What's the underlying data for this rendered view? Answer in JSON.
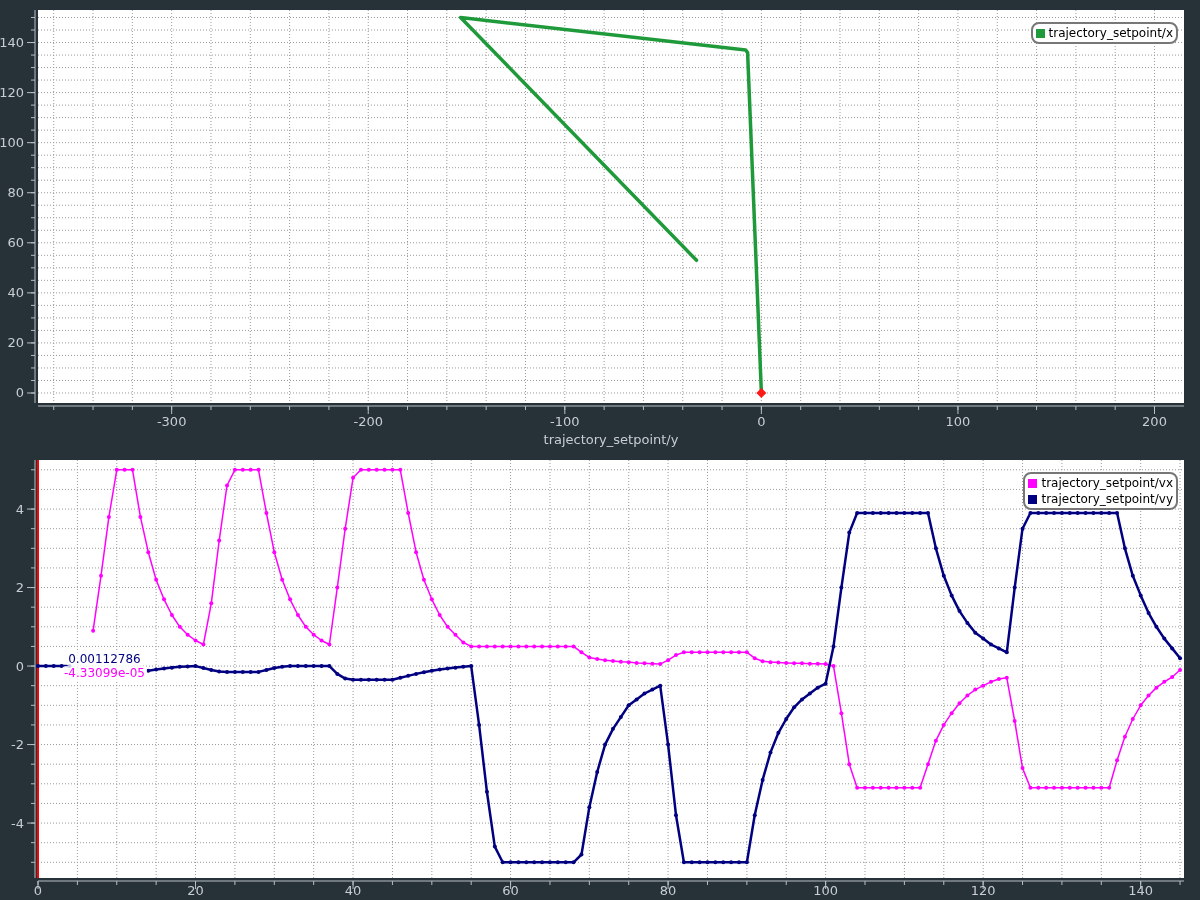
{
  "plots": [
    {
      "chart_data": {
        "type": "line",
        "grid": true,
        "legend": "top-right",
        "xlabel": "trajectory_setpoint/y",
        "xlim": [
          -368,
          215
        ],
        "ylim": [
          -4,
          153
        ],
        "xticks": [
          -300,
          -200,
          -100,
          0,
          100,
          200
        ],
        "yticks": [
          0,
          20,
          40,
          60,
          80,
          100,
          120,
          140
        ],
        "x": [
          -33,
          -153,
          -8,
          -7,
          0
        ],
        "series": [
          {
            "name": "trajectory_setpoint/x",
            "color": "#1f9a3a",
            "values": [
              53,
              150,
              137,
              136,
              0
            ]
          }
        ]
      }
    },
    {
      "chart_data": {
        "type": "line",
        "grid": true,
        "legend": "top-right",
        "xlim": [
          0,
          145.5
        ],
        "ylim": [
          -5.4,
          5.25
        ],
        "xticks": [
          0,
          20,
          40,
          60,
          80,
          100,
          120,
          140
        ],
        "yticks": [
          -4,
          -2,
          0,
          2,
          4
        ],
        "x": [
          0,
          1,
          2,
          3,
          4,
          7,
          8,
          9,
          10,
          11,
          12,
          13,
          14,
          15,
          16,
          17,
          18,
          19,
          20,
          21,
          22,
          23,
          24,
          25,
          26,
          27,
          28,
          29,
          30,
          31,
          32,
          33,
          34,
          35,
          36,
          37,
          38,
          39,
          40,
          41,
          42,
          43,
          44,
          45,
          46,
          47,
          48,
          49,
          50,
          51,
          52,
          53,
          54,
          55,
          56,
          57,
          58,
          59,
          60,
          61,
          62,
          63,
          64,
          65,
          66,
          67,
          68,
          69,
          70,
          71,
          72,
          73,
          74,
          75,
          76,
          77,
          78,
          79,
          80,
          81,
          82,
          83,
          84,
          85,
          86,
          87,
          88,
          89,
          90,
          91,
          92,
          93,
          94,
          95,
          96,
          97,
          98,
          99,
          100,
          101,
          102,
          103,
          104,
          105,
          106,
          107,
          108,
          109,
          110,
          111,
          112,
          113,
          114,
          115,
          116,
          117,
          118,
          119,
          120,
          121,
          122,
          123,
          124,
          125,
          126,
          127,
          128,
          129,
          130,
          131,
          132,
          133,
          134,
          135,
          136,
          137,
          138,
          139,
          140,
          141,
          142,
          143,
          144,
          145
        ],
        "series": [
          {
            "name": "trajectory_setpoint/vx",
            "color": "#ff00ff",
            "values": [
              null,
              null,
              null,
              null,
              null,
              0.9,
              2.3,
              3.8,
              5,
              5,
              5,
              3.8,
              2.9,
              2.2,
              1.7,
              1.3,
              1.0,
              0.8,
              0.65,
              0.55,
              1.6,
              3.2,
              4.6,
              5,
              5,
              5,
              5,
              3.9,
              2.9,
              2.2,
              1.7,
              1.3,
              1.0,
              0.8,
              0.65,
              0.55,
              2.0,
              3.5,
              4.8,
              5,
              5,
              5,
              5,
              5,
              5,
              3.9,
              2.9,
              2.2,
              1.7,
              1.3,
              1.0,
              0.8,
              0.6,
              0.5,
              0.5,
              0.5,
              0.5,
              0.5,
              0.5,
              0.5,
              0.5,
              0.5,
              0.5,
              0.5,
              0.5,
              0.5,
              0.5,
              0.35,
              0.22,
              0.18,
              0.15,
              0.13,
              0.11,
              0.1,
              0.08,
              0.07,
              0.06,
              0.05,
              0.15,
              0.28,
              0.35,
              0.35,
              0.35,
              0.35,
              0.35,
              0.35,
              0.35,
              0.35,
              0.35,
              0.2,
              0.12,
              0.1,
              0.09,
              0.08,
              0.07,
              0.07,
              0.06,
              0.06,
              0.05,
              0,
              -1.2,
              -2.5,
              -3.1,
              -3.1,
              -3.1,
              -3.1,
              -3.1,
              -3.1,
              -3.1,
              -3.1,
              -3.1,
              -2.5,
              -1.9,
              -1.5,
              -1.2,
              -0.95,
              -0.75,
              -0.6,
              -0.5,
              -0.4,
              -0.33,
              -0.3,
              -1.4,
              -2.6,
              -3.1,
              -3.1,
              -3.1,
              -3.1,
              -3.1,
              -3.1,
              -3.1,
              -3.1,
              -3.1,
              -3.1,
              -3.1,
              -2.4,
              -1.8,
              -1.35,
              -1.0,
              -0.75,
              -0.55,
              -0.4,
              -0.28,
              -0.1
            ]
          },
          {
            "name": "trajectory_setpoint/vy",
            "color": "#000080",
            "values": [
              0,
              0,
              0,
              0,
              0,
              null,
              null,
              null,
              null,
              null,
              null,
              null,
              -0.12,
              -0.09,
              -0.06,
              -0.04,
              -0.02,
              -0.01,
              0,
              -0.05,
              -0.1,
              -0.14,
              -0.15,
              -0.15,
              -0.15,
              -0.15,
              -0.15,
              -0.1,
              -0.05,
              -0.02,
              0,
              0,
              0,
              0,
              0,
              0,
              -0.2,
              -0.32,
              -0.35,
              -0.35,
              -0.35,
              -0.35,
              -0.35,
              -0.35,
              -0.3,
              -0.25,
              -0.2,
              -0.16,
              -0.12,
              -0.09,
              -0.06,
              -0.04,
              -0.02,
              0,
              -1.5,
              -3.2,
              -4.6,
              -5,
              -5,
              -5,
              -5,
              -5,
              -5,
              -5,
              -5,
              -5,
              -5,
              -4.8,
              -3.6,
              -2.7,
              -2.0,
              -1.6,
              -1.3,
              -1.0,
              -0.85,
              -0.7,
              -0.6,
              -0.5,
              -2.0,
              -3.8,
              -5,
              -5,
              -5,
              -5,
              -5,
              -5,
              -5,
              -5,
              -5,
              -3.8,
              -2.9,
              -2.2,
              -1.7,
              -1.35,
              -1.05,
              -0.85,
              -0.7,
              -0.55,
              -0.45,
              0.5,
              2.0,
              3.4,
              3.9,
              3.9,
              3.9,
              3.9,
              3.9,
              3.9,
              3.9,
              3.9,
              3.9,
              3.9,
              3.0,
              2.3,
              1.8,
              1.4,
              1.1,
              0.85,
              0.7,
              0.55,
              0.45,
              0.35,
              2.0,
              3.5,
              3.9,
              3.9,
              3.9,
              3.9,
              3.9,
              3.9,
              3.9,
              3.9,
              3.9,
              3.9,
              3.9,
              3.9,
              3.0,
              2.3,
              1.8,
              1.35,
              1.0,
              0.7,
              0.45,
              0.2
            ]
          }
        ],
        "ref_lines": [
          {
            "axis": "x",
            "value": 0
          }
        ],
        "annotations": [
          "0.00112786",
          "-4.33099e-05"
        ]
      }
    }
  ]
}
